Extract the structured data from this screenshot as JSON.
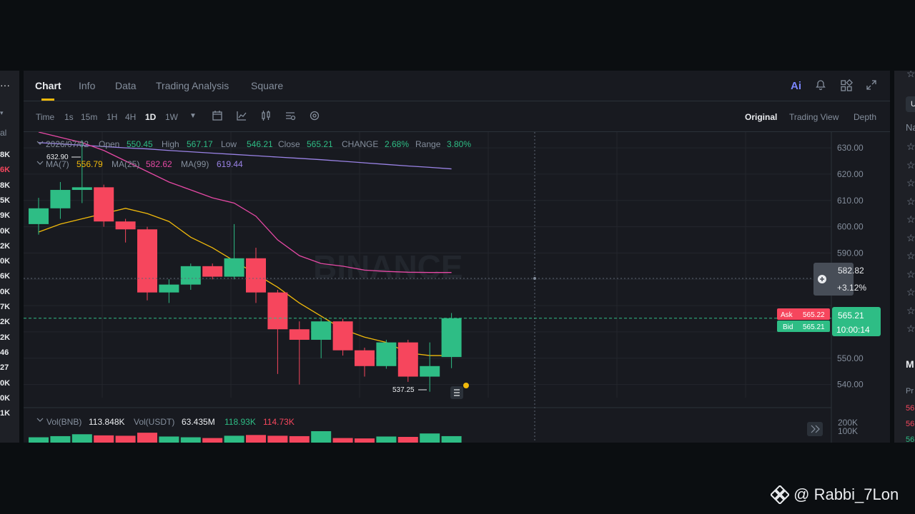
{
  "left_panel": {
    "menu_glyph": "···",
    "dropdown_glyph": "▾",
    "label_fragment": "al",
    "cut_values": [
      {
        "text": "8K",
        "color": "white"
      },
      {
        "text": "6K",
        "color": "red"
      },
      {
        "text": "8K",
        "color": "white"
      },
      {
        "text": "5K",
        "color": "white"
      },
      {
        "text": "9K",
        "color": "white"
      },
      {
        "text": "0K",
        "color": "white"
      },
      {
        "text": "2K",
        "color": "white"
      },
      {
        "text": "0K",
        "color": "white"
      },
      {
        "text": "6K",
        "color": "white"
      },
      {
        "text": "0K",
        "color": "white"
      },
      {
        "text": "7K",
        "color": "white"
      },
      {
        "text": "2K",
        "color": "white"
      },
      {
        "text": "2K",
        "color": "white"
      },
      {
        "text": "46",
        "color": "white"
      },
      {
        "text": "27",
        "color": "white"
      },
      {
        "text": "0K",
        "color": "white"
      },
      {
        "text": "0K",
        "color": "white"
      },
      {
        "text": "1K",
        "color": "white"
      }
    ]
  },
  "right_panel": {
    "chip_text": "U",
    "header_fragment": "Na",
    "section_fragment": "M",
    "price_fragment": "Pr",
    "value_fragments": [
      {
        "text": "56",
        "color": "#f6465d"
      },
      {
        "text": "56",
        "color": "#f6465d"
      },
      {
        "text": "56",
        "color": "#2ebd85"
      }
    ]
  },
  "tabs": [
    "Chart",
    "Info",
    "Data",
    "Trading Analysis",
    "Square"
  ],
  "header_icons": {
    "ai": "Ai",
    "bell": "bell-icon",
    "grid": "grid-icon",
    "expand": "expand-icon"
  },
  "toolbar": {
    "timeframes": [
      "Time",
      "1s",
      "15m",
      "1H",
      "4H",
      "1D",
      "1W"
    ],
    "active_timeframe": "1D",
    "views": [
      "Original",
      "Trading View",
      "Depth"
    ],
    "active_view": "Original"
  },
  "ohlc": {
    "date": "2026/07/02",
    "open_label": "Open",
    "open": "550.45",
    "high_label": "High",
    "high": "567.17",
    "low_label": "Low",
    "low": "546.21",
    "close_label": "Close",
    "close": "565.21",
    "change_label": "CHANGE",
    "change": "2.68%",
    "range_label": "Range",
    "range": "3.80%"
  },
  "ma": {
    "ma7_label": "MA(7)",
    "ma7": "556.79",
    "ma25_label": "MA(25)",
    "ma25": "582.62",
    "ma99_label": "MA(99)",
    "ma99": "619.44"
  },
  "volume": {
    "bnb_label": "Vol(BNB)",
    "bnb": "113.848K",
    "usdt_label": "Vol(USDT)",
    "usdt": "63.435M",
    "v1": "118.93K",
    "v2": "114.73K",
    "axis": [
      "200K",
      "100K"
    ]
  },
  "price_axis": [
    "630.00",
    "620.00",
    "610.00",
    "600.00",
    "590.00",
    "550.00",
    "540.00"
  ],
  "crosshair": {
    "price": "582.82",
    "pct": "+3.12%"
  },
  "ask": {
    "label": "Ask",
    "value": "565.22"
  },
  "bid": {
    "label": "Bid",
    "value": "565.21"
  },
  "last": {
    "price": "565.21",
    "countdown": "10:00:14"
  },
  "marks": {
    "high": "632.90",
    "low": "537.25"
  },
  "watermark_bg": "BINANCE",
  "credit": "@ Rabbi_7Lon",
  "colors": {
    "up": "#2ebd85",
    "down": "#f6465d",
    "ma7": "#f0b90b",
    "ma25": "#e649a5",
    "ma99": "#9a83e6",
    "accent": "#f0b90b"
  },
  "chart_data": {
    "type": "candlestick",
    "ylim": [
      535,
      636
    ],
    "candles": [
      {
        "o": 601,
        "c": 607,
        "h": 611,
        "l": 597
      },
      {
        "o": 607,
        "c": 614,
        "h": 617,
        "l": 603
      },
      {
        "o": 614,
        "c": 615,
        "h": 632.9,
        "l": 609
      },
      {
        "o": 615,
        "c": 602,
        "h": 616,
        "l": 600
      },
      {
        "o": 602,
        "c": 599,
        "h": 603,
        "l": 594
      },
      {
        "o": 599,
        "c": 575,
        "h": 600,
        "l": 572
      },
      {
        "o": 575,
        "c": 578,
        "h": 580,
        "l": 571
      },
      {
        "o": 578,
        "c": 585,
        "h": 586,
        "l": 576
      },
      {
        "o": 585,
        "c": 581,
        "h": 586,
        "l": 580
      },
      {
        "o": 581,
        "c": 588,
        "h": 601,
        "l": 580
      },
      {
        "o": 588,
        "c": 575,
        "h": 592,
        "l": 571
      },
      {
        "o": 575,
        "c": 561,
        "h": 576,
        "l": 544
      },
      {
        "o": 561,
        "c": 557,
        "h": 564,
        "l": 540
      },
      {
        "o": 557,
        "c": 564,
        "h": 565,
        "l": 550
      },
      {
        "o": 564,
        "c": 553,
        "h": 565,
        "l": 551
      },
      {
        "o": 553,
        "c": 547,
        "h": 554,
        "l": 543
      },
      {
        "o": 547,
        "c": 556,
        "h": 557,
        "l": 546
      },
      {
        "o": 556,
        "c": 543,
        "h": 557,
        "l": 541
      },
      {
        "o": 543,
        "c": 547,
        "h": 556,
        "l": 537.25
      },
      {
        "o": 550.45,
        "c": 565.21,
        "h": 567.17,
        "l": 546.21
      }
    ],
    "ma7": [
      598,
      601,
      603,
      605,
      607,
      605,
      602,
      596,
      592,
      587,
      582,
      577,
      571,
      566,
      561,
      558,
      556,
      552,
      551,
      551
    ],
    "ma25": [
      636,
      634,
      632,
      629,
      625,
      621,
      617,
      614,
      611,
      609,
      604,
      595,
      589,
      586,
      585,
      583.5,
      583,
      582.7,
      582.6,
      582.6
    ],
    "ma99": [
      632,
      631.5,
      631,
      630.5,
      630,
      629.6,
      629,
      628.5,
      628,
      627.5,
      627,
      626.5,
      626,
      625.5,
      624.9,
      624.3,
      623.7,
      623.1,
      622.6,
      622
    ],
    "volume_colors": [
      "up",
      "up",
      "up",
      "down",
      "down",
      "down",
      "up",
      "up",
      "down",
      "up",
      "down",
      "down",
      "down",
      "up",
      "down",
      "down",
      "up",
      "down",
      "up",
      "up"
    ],
    "volume_values": [
      70,
      85,
      110,
      95,
      90,
      130,
      80,
      70,
      60,
      90,
      100,
      90,
      85,
      150,
      60,
      55,
      80,
      75,
      120,
      85
    ]
  }
}
